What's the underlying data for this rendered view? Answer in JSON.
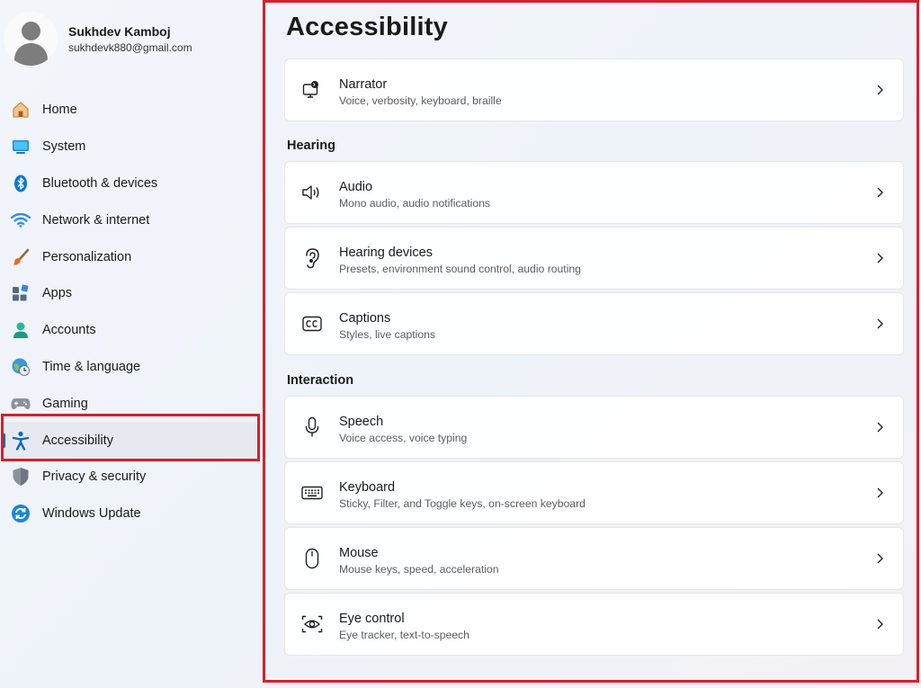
{
  "profile": {
    "name": "Sukhdev Kamboj",
    "email": "sukhdevk880@gmail.com"
  },
  "sidebar": {
    "items": [
      {
        "label": "Home",
        "icon": "home-icon"
      },
      {
        "label": "System",
        "icon": "system-icon"
      },
      {
        "label": "Bluetooth & devices",
        "icon": "bluetooth-icon"
      },
      {
        "label": "Network & internet",
        "icon": "wifi-icon"
      },
      {
        "label": "Personalization",
        "icon": "brush-icon"
      },
      {
        "label": "Apps",
        "icon": "apps-icon"
      },
      {
        "label": "Accounts",
        "icon": "accounts-icon"
      },
      {
        "label": "Time & language",
        "icon": "globe-clock-icon"
      },
      {
        "label": "Gaming",
        "icon": "gamepad-icon"
      },
      {
        "label": "Accessibility",
        "icon": "accessibility-icon",
        "active": true
      },
      {
        "label": "Privacy & security",
        "icon": "shield-icon"
      },
      {
        "label": "Windows Update",
        "icon": "update-icon"
      }
    ]
  },
  "main": {
    "title": "Accessibility",
    "sections": {
      "hearing": "Hearing",
      "interaction": "Interaction"
    },
    "cards": [
      {
        "title": "Narrator",
        "subtitle": "Voice, verbosity, keyboard, braille",
        "icon": "narrator-icon"
      },
      {
        "title": "Audio",
        "subtitle": "Mono audio, audio notifications",
        "icon": "speaker-icon"
      },
      {
        "title": "Hearing devices",
        "subtitle": "Presets, environment sound control, audio routing",
        "icon": "ear-icon"
      },
      {
        "title": "Captions",
        "subtitle": "Styles, live captions",
        "icon": "captions-icon"
      },
      {
        "title": "Speech",
        "subtitle": "Voice access, voice typing",
        "icon": "microphone-icon"
      },
      {
        "title": "Keyboard",
        "subtitle": "Sticky, Filter, and Toggle keys, on-screen keyboard",
        "icon": "keyboard-icon"
      },
      {
        "title": "Mouse",
        "subtitle": "Mouse keys, speed, acceleration",
        "icon": "mouse-icon"
      },
      {
        "title": "Eye control",
        "subtitle": "Eye tracker, text-to-speech",
        "icon": "eye-control-icon"
      }
    ]
  },
  "colors": {
    "accent": "#0067c0",
    "highlight_border": "#d5202d"
  }
}
